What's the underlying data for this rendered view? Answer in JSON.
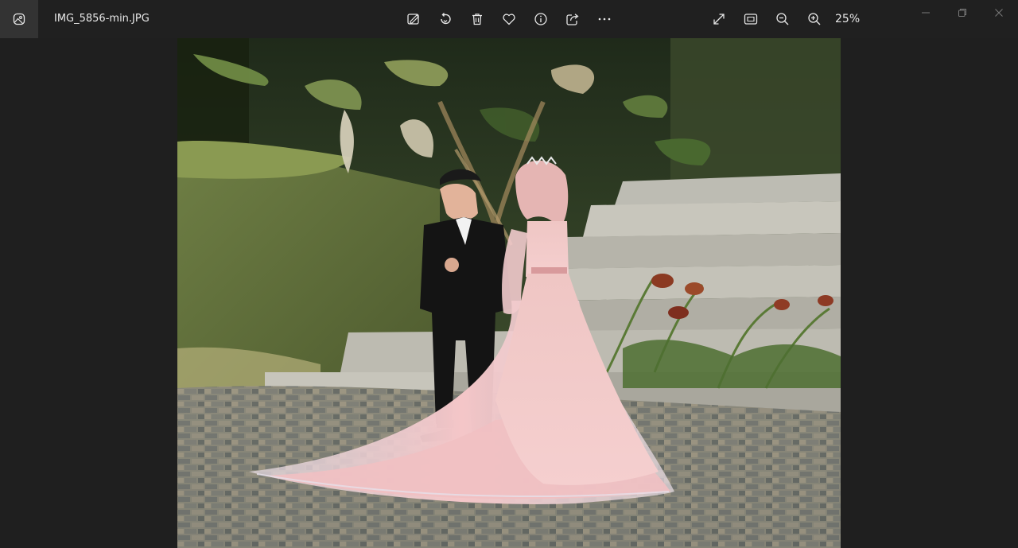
{
  "window": {
    "file_name": "IMG_5856-min.JPG"
  },
  "toolbar": {
    "icons": [
      "edit-image-icon",
      "rotate-icon",
      "delete-icon",
      "favorite-icon",
      "info-icon",
      "share-icon",
      "more-icon"
    ],
    "view_icons": [
      "fullscreen-icon",
      "fit-to-window-icon",
      "zoom-out-icon",
      "zoom-in-icon"
    ],
    "zoom_label": "25%"
  },
  "colors": {
    "titlebar": "#202020",
    "canvas": "#1f1f1f",
    "icon": "#e6e6e6",
    "window_controls": "#7a7a7a"
  }
}
